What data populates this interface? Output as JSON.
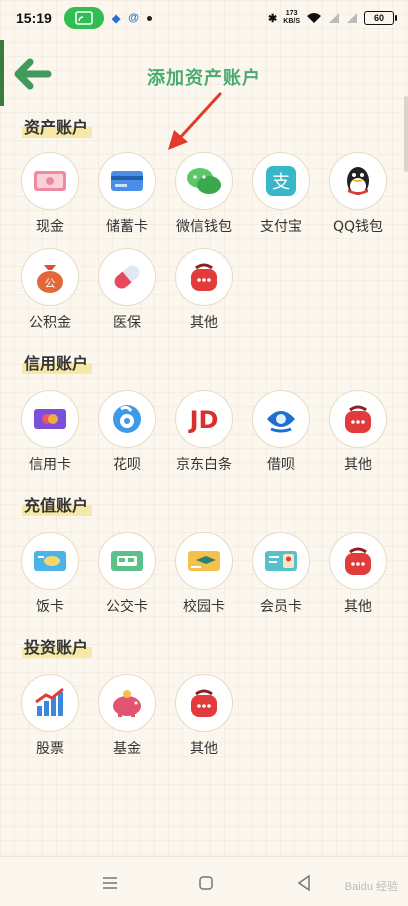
{
  "status": {
    "time": "15:19",
    "net_speed_top": "173",
    "net_speed_bottom": "KB/S",
    "battery": "60"
  },
  "header": {
    "title": "添加资产账户"
  },
  "sections": [
    {
      "title": "资产账户",
      "items": [
        {
          "label": "现金",
          "icon": "cash-icon"
        },
        {
          "label": "储蓄卡",
          "icon": "savings-card-icon"
        },
        {
          "label": "微信钱包",
          "icon": "wechat-wallet-icon"
        },
        {
          "label": "支付宝",
          "icon": "alipay-icon"
        },
        {
          "label": "QQ钱包",
          "icon": "qq-wallet-icon"
        },
        {
          "label": "公积金",
          "icon": "provident-fund-icon"
        },
        {
          "label": "医保",
          "icon": "medical-insurance-icon"
        },
        {
          "label": "其他",
          "icon": "other-bag-icon"
        }
      ]
    },
    {
      "title": "信用账户",
      "items": [
        {
          "label": "信用卡",
          "icon": "credit-card-icon"
        },
        {
          "label": "花呗",
          "icon": "huabei-icon"
        },
        {
          "label": "京东白条",
          "icon": "jd-baitiao-icon"
        },
        {
          "label": "借呗",
          "icon": "jiebei-icon"
        },
        {
          "label": "其他",
          "icon": "other-bag-icon"
        }
      ]
    },
    {
      "title": "充值账户",
      "items": [
        {
          "label": "饭卡",
          "icon": "meal-card-icon"
        },
        {
          "label": "公交卡",
          "icon": "bus-card-icon"
        },
        {
          "label": "校园卡",
          "icon": "campus-card-icon"
        },
        {
          "label": "会员卡",
          "icon": "member-card-icon"
        },
        {
          "label": "其他",
          "icon": "other-bag-icon"
        }
      ]
    },
    {
      "title": "投资账户",
      "items": [
        {
          "label": "股票",
          "icon": "stocks-icon"
        },
        {
          "label": "基金",
          "icon": "fund-piggy-icon"
        },
        {
          "label": "其他",
          "icon": "other-bag-icon"
        }
      ]
    }
  ],
  "watermark": "Baidu 经验",
  "colors": {
    "accent": "#4aab72",
    "back_arrow": "#3f9a5c",
    "pointer_arrow": "#e23b2e"
  }
}
